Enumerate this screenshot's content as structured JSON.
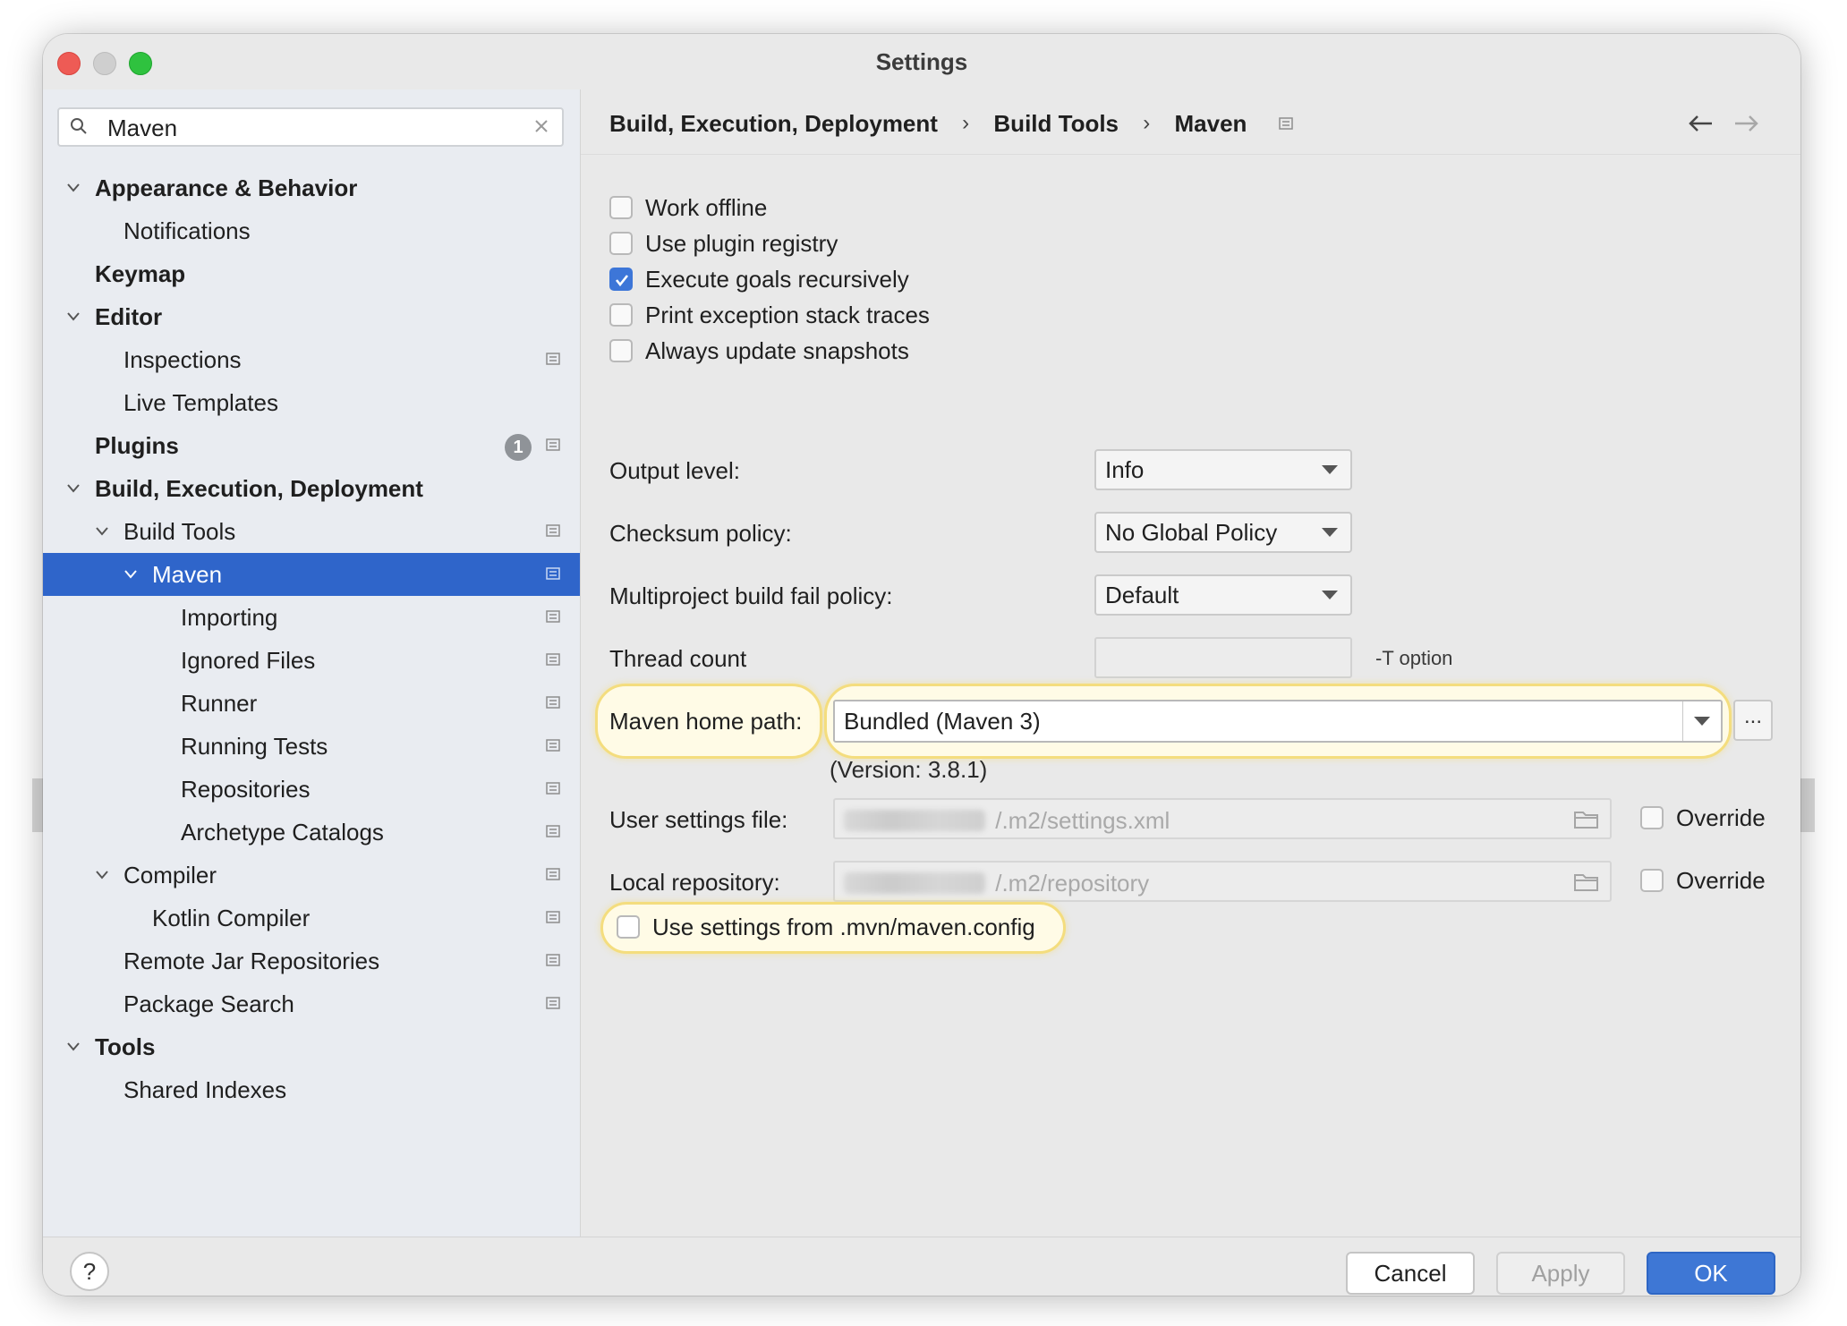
{
  "window": {
    "title": "Settings"
  },
  "search": {
    "value": "Maven"
  },
  "tree": [
    {
      "label": "Appearance & Behavior",
      "level": 0,
      "bold": true,
      "expanded": true
    },
    {
      "label": "Notifications",
      "level": 1
    },
    {
      "label": "Keymap",
      "level": 0,
      "bold": true
    },
    {
      "label": "Editor",
      "level": 0,
      "bold": true,
      "expanded": true
    },
    {
      "label": "Inspections",
      "level": 1,
      "icon": "page-icon"
    },
    {
      "label": "Live Templates",
      "level": 1
    },
    {
      "label": "Plugins",
      "level": 0,
      "bold": true,
      "badge": "1",
      "icon": "page-icon"
    },
    {
      "label": "Build, Execution, Deployment",
      "level": 0,
      "bold": true,
      "expanded": true
    },
    {
      "label": "Build Tools",
      "level": 1,
      "expanded": true,
      "icon": "page-icon"
    },
    {
      "label": "Maven",
      "level": 2,
      "expanded": true,
      "selected": true,
      "icon": "page-icon"
    },
    {
      "label": "Importing",
      "level": 3,
      "icon": "page-icon"
    },
    {
      "label": "Ignored Files",
      "level": 3,
      "icon": "page-icon"
    },
    {
      "label": "Runner",
      "level": 3,
      "icon": "page-icon"
    },
    {
      "label": "Running Tests",
      "level": 3,
      "icon": "page-icon"
    },
    {
      "label": "Repositories",
      "level": 3,
      "icon": "page-icon"
    },
    {
      "label": "Archetype Catalogs",
      "level": 3,
      "icon": "page-icon"
    },
    {
      "label": "Compiler",
      "level": 1,
      "expanded": true,
      "icon": "page-icon"
    },
    {
      "label": "Kotlin Compiler",
      "level": 2,
      "icon": "page-icon"
    },
    {
      "label": "Remote Jar Repositories",
      "level": 1,
      "icon": "page-icon"
    },
    {
      "label": "Package Search",
      "level": 1,
      "icon": "page-icon"
    },
    {
      "label": "Tools",
      "level": 0,
      "bold": true,
      "expanded": true
    },
    {
      "label": "Shared Indexes",
      "level": 1
    }
  ],
  "breadcrumb": [
    "Build, Execution, Deployment",
    "Build Tools",
    "Maven"
  ],
  "breadcrumb_separator": "›",
  "options": [
    {
      "label": "Work offline",
      "checked": false
    },
    {
      "label": "Use plugin registry",
      "checked": false
    },
    {
      "label": "Execute goals recursively",
      "checked": true
    },
    {
      "label": "Print exception stack traces",
      "checked": false
    },
    {
      "label": "Always update snapshots",
      "checked": false
    }
  ],
  "output_level": {
    "label": "Output level:",
    "value": "Info"
  },
  "checksum_policy": {
    "label": "Checksum policy:",
    "value": "No Global Policy"
  },
  "fail_policy": {
    "label": "Multiproject build fail policy:",
    "value": "Default"
  },
  "thread_count": {
    "label": "Thread count",
    "value": "",
    "hint": "-T option"
  },
  "maven_home": {
    "label": "Maven home path:",
    "value": "Bundled (Maven 3)",
    "browse_label": "...",
    "version": "(Version: 3.8.1)"
  },
  "user_settings": {
    "label": "User settings file:",
    "value": "/.m2/settings.xml",
    "override_label": "Override",
    "override_checked": false
  },
  "local_repo": {
    "label": "Local repository:",
    "value": "/.m2/repository",
    "override_label": "Override",
    "override_checked": false
  },
  "use_mvn_config": {
    "label": "Use settings from .mvn/maven.config",
    "checked": false
  },
  "footer": {
    "help_label": "?",
    "cancel": "Cancel",
    "apply": "Apply",
    "ok": "OK"
  },
  "colors": {
    "selection": "#2f65ca",
    "ok_button": "#3e77d5",
    "checkbox_checked": "#3d76d8",
    "highlight": "#f4dd7e"
  }
}
